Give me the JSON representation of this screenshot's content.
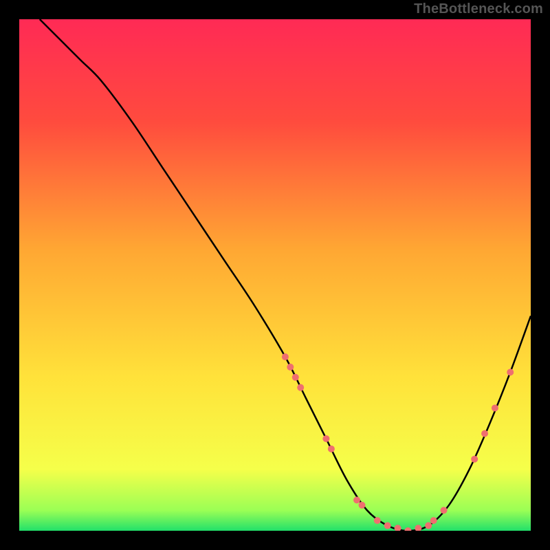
{
  "watermark": "TheBottleneck.com",
  "chart_data": {
    "type": "line",
    "title": "",
    "xlabel": "",
    "ylabel": "",
    "xlim": [
      0,
      100
    ],
    "ylim": [
      0,
      100
    ],
    "background_gradient": {
      "stops": [
        {
          "offset": 0,
          "color": "#ff2a55"
        },
        {
          "offset": 20,
          "color": "#ff4b3e"
        },
        {
          "offset": 45,
          "color": "#ffa733"
        },
        {
          "offset": 70,
          "color": "#ffe23a"
        },
        {
          "offset": 88,
          "color": "#f5ff4a"
        },
        {
          "offset": 96,
          "color": "#9bff55"
        },
        {
          "offset": 100,
          "color": "#22e06a"
        }
      ]
    },
    "series": [
      {
        "name": "bottleneck-curve",
        "color": "#000000",
        "x": [
          4,
          8,
          12,
          16,
          22,
          28,
          34,
          40,
          46,
          52,
          56,
          60,
          64,
          68,
          72,
          76,
          80,
          84,
          88,
          92,
          96,
          100
        ],
        "y": [
          100,
          96,
          92,
          88,
          80,
          71,
          62,
          53,
          44,
          34,
          26,
          18,
          10,
          4,
          1,
          0,
          1,
          5,
          12,
          21,
          31,
          42
        ]
      }
    ],
    "markers": {
      "name": "highlight-points",
      "color": "#ef6f6f",
      "radius": 5,
      "points": [
        {
          "x": 52,
          "y": 34
        },
        {
          "x": 53,
          "y": 32
        },
        {
          "x": 54,
          "y": 30
        },
        {
          "x": 55,
          "y": 28
        },
        {
          "x": 60,
          "y": 18
        },
        {
          "x": 61,
          "y": 16
        },
        {
          "x": 66,
          "y": 6
        },
        {
          "x": 67,
          "y": 5
        },
        {
          "x": 70,
          "y": 2
        },
        {
          "x": 72,
          "y": 1
        },
        {
          "x": 74,
          "y": 0.5
        },
        {
          "x": 76,
          "y": 0
        },
        {
          "x": 78,
          "y": 0.5
        },
        {
          "x": 80,
          "y": 1
        },
        {
          "x": 81,
          "y": 2
        },
        {
          "x": 83,
          "y": 4
        },
        {
          "x": 89,
          "y": 14
        },
        {
          "x": 91,
          "y": 19
        },
        {
          "x": 93,
          "y": 24
        },
        {
          "x": 96,
          "y": 31
        }
      ]
    }
  }
}
